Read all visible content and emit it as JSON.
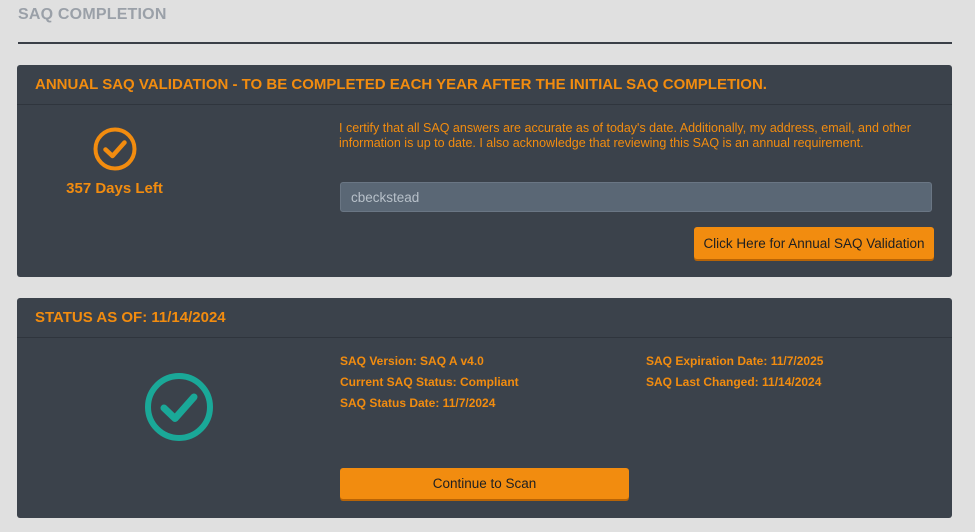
{
  "page": {
    "title": "SAQ COMPLETION"
  },
  "annual": {
    "header": "ANNUAL SAQ VALIDATION - TO BE COMPLETED EACH YEAR AFTER THE INITIAL SAQ COMPLETION.",
    "days_left": "357 Days Left",
    "certify_text": "I certify that all SAQ answers are accurate as of today's date. Additionally, my address, email, and other information is up to date. I also acknowledge that reviewing this SAQ is an annual requirement.",
    "username_value": "cbeckstead",
    "button_label": "Click Here for Annual SAQ Validation",
    "icon": "check-circle-icon",
    "accent_color": "#f28c0f"
  },
  "status": {
    "header": "STATUS AS OF: 11/14/2024",
    "details_left": [
      "SAQ Version: SAQ A v4.0",
      "Current SAQ Status: Compliant",
      "SAQ Status Date: 11/7/2024"
    ],
    "details_right": [
      "SAQ Expiration Date: 11/7/2025",
      "SAQ Last Changed: 11/14/2024"
    ],
    "button_label": "Continue to Scan",
    "icon": "check-circle-icon",
    "icon_color": "#1aa898"
  }
}
